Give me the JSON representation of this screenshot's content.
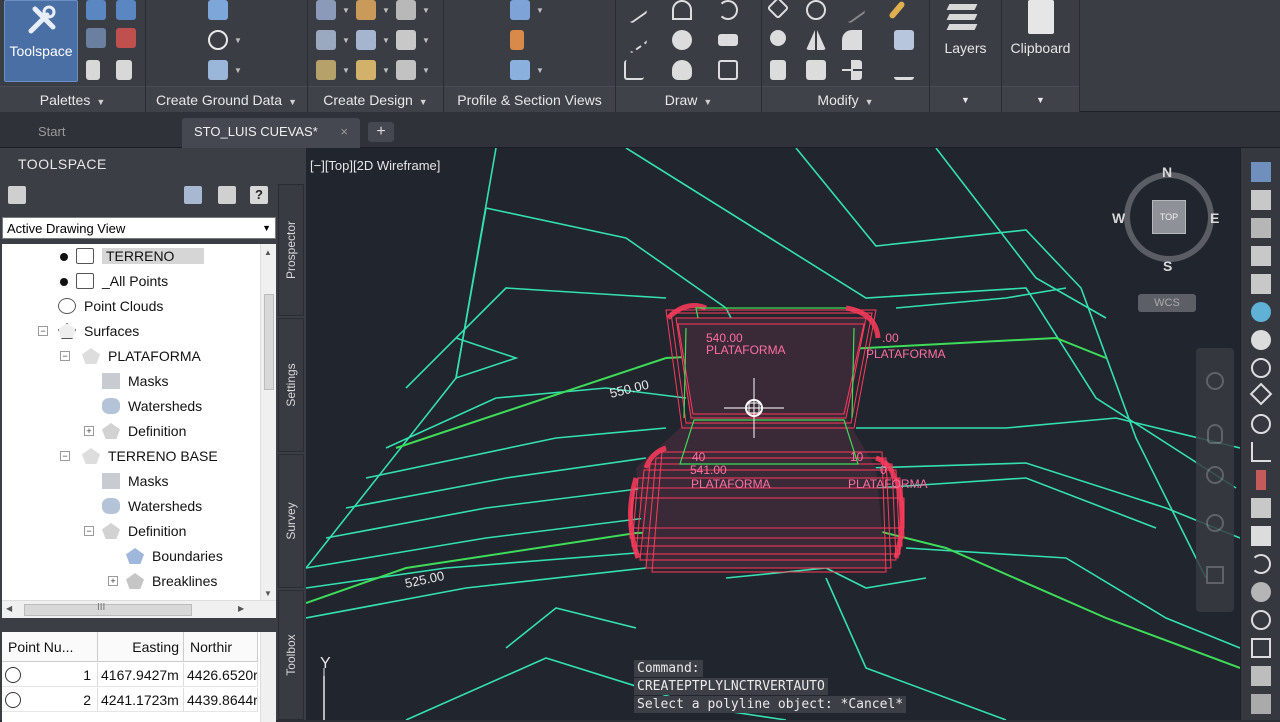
{
  "ribbon": {
    "panels": [
      {
        "title": "Palettes",
        "has_menu": true
      },
      {
        "title": "Create Ground Data",
        "has_menu": true
      },
      {
        "title": "Create Design",
        "has_menu": true
      },
      {
        "title": "Profile & Section Views",
        "has_menu": false
      },
      {
        "title": "Draw",
        "has_menu": true
      },
      {
        "title": "Modify",
        "has_menu": true
      }
    ],
    "toolspace_button": "Toolspace",
    "layers_button": "Layers",
    "clipboard_button": "Clipboard"
  },
  "tabs": {
    "start": "Start",
    "active": "STO_LUIS CUEVAS*",
    "close_symbol": "×",
    "add_symbol": "+"
  },
  "toolspace": {
    "title": "TOOLSPACE",
    "view_select": "Active Drawing View",
    "side_tabs": [
      "Prospector",
      "Settings",
      "Survey",
      "Toolbox"
    ],
    "tree": [
      {
        "label": "TERRENO",
        "icon": "point-group-icon"
      },
      {
        "label": "_All Points",
        "icon": "point-group-icon"
      },
      {
        "label": "Point Clouds",
        "icon": "point-cloud-icon"
      },
      {
        "label": "Surfaces",
        "icon": "surfaces-icon"
      },
      {
        "label": "PLATAFORMA",
        "icon": "surface-icon"
      },
      {
        "label": "Masks",
        "icon": "masks-icon"
      },
      {
        "label": "Watersheds",
        "icon": "watersheds-icon"
      },
      {
        "label": "Definition",
        "icon": "definition-icon"
      },
      {
        "label": "TERRENO BASE",
        "icon": "surface-icon"
      },
      {
        "label": "Masks",
        "icon": "masks-icon"
      },
      {
        "label": "Watersheds",
        "icon": "watersheds-icon"
      },
      {
        "label": "Definition",
        "icon": "definition-icon"
      },
      {
        "label": "Boundaries",
        "icon": "boundaries-icon"
      },
      {
        "label": "Breaklines",
        "icon": "breaklines-icon"
      }
    ],
    "hscroll_label": "III",
    "points_table": {
      "columns": [
        "Point Nu...",
        "Easting",
        "Northir"
      ],
      "rows": [
        {
          "number": "1",
          "easting": "4167.9427m",
          "northing": "4426.6520r"
        },
        {
          "number": "2",
          "easting": "4241.1723m",
          "northing": "4439.8644r"
        }
      ]
    }
  },
  "viewport": {
    "label": "[−][Top][2D Wireframe]",
    "contour_labels": [
      "550.00",
      "525.00"
    ],
    "surface_labels": [
      "PLATAFORMA",
      "PLATAFORMA",
      "PLATAFORMA",
      "PLATAFORMA"
    ],
    "elevation_labels": [
      "540.00",
      ".00",
      "40",
      "541.00",
      "10",
      "0"
    ],
    "viewcube": {
      "north": "N",
      "south": "S",
      "east": "E",
      "west": "W",
      "face": "TOP",
      "ucs": "WCS"
    },
    "ucs_axis": "Y",
    "command_lines": [
      "Command:",
      "CREATEPTPLYLNCTRVERTAUTO",
      "Select a polyline object: *Cancel*"
    ]
  },
  "colors": {
    "contour_major": "#3fdc5a",
    "contour_minor": "#35e0b0",
    "grading": "#ff3b5c",
    "surface_text": "#ff6fa0",
    "viewport_bg": "#21252d"
  }
}
